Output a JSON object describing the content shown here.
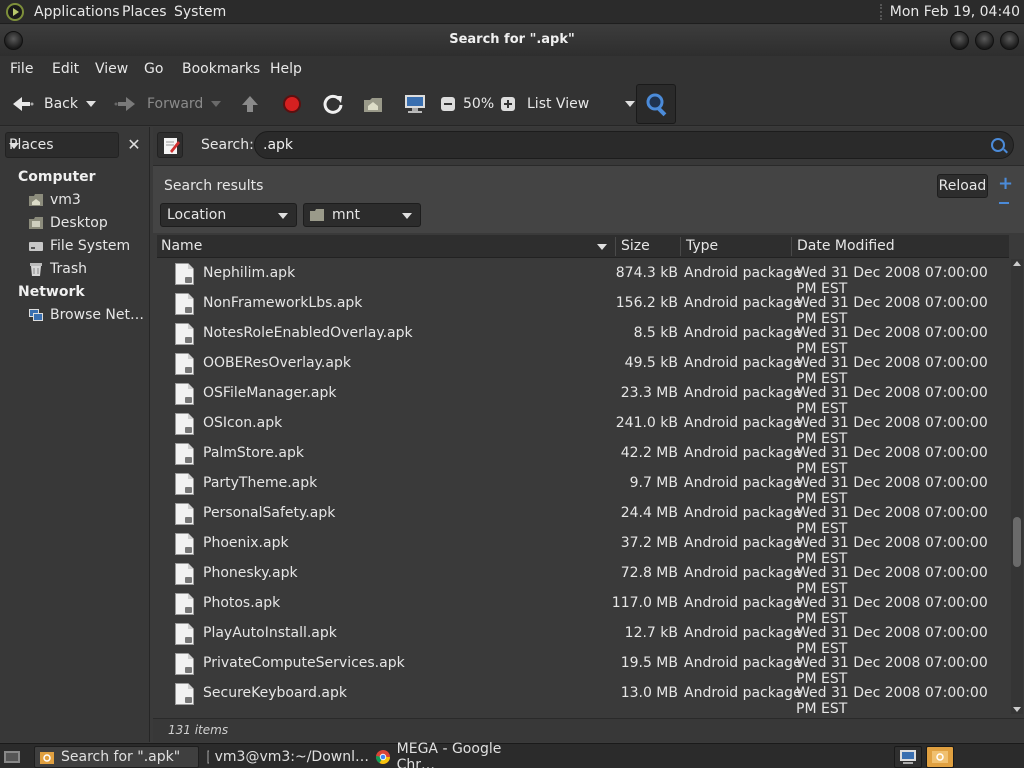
{
  "top_panel": {
    "menus": [
      "Applications",
      "Places",
      "System"
    ],
    "clock": "Mon Feb 19, 04:40"
  },
  "window": {
    "title": "Search for \".apk\""
  },
  "menubar": [
    "File",
    "Edit",
    "View",
    "Go",
    "Bookmarks",
    "Help"
  ],
  "toolbar": {
    "back_label": "Back",
    "forward_label": "Forward",
    "zoom_level": "50%",
    "view_mode": "List View"
  },
  "sidebar": {
    "selector_label": "Places",
    "sections": [
      {
        "heading": "Computer",
        "items": [
          {
            "label": "vm3",
            "icon": "home-folder-icon"
          },
          {
            "label": "Desktop",
            "icon": "desktop-folder-icon"
          },
          {
            "label": "File System",
            "icon": "drive-icon"
          },
          {
            "label": "Trash",
            "icon": "trash-icon"
          }
        ]
      },
      {
        "heading": "Network",
        "items": [
          {
            "label": "Browse Net…",
            "icon": "network-icon"
          }
        ]
      }
    ]
  },
  "search": {
    "label": "Search:",
    "query": ".apk",
    "results_title": "Search results",
    "reload_label": "Reload",
    "filter_type": "Location",
    "filter_value": "mnt"
  },
  "columns": {
    "name": "Name",
    "size": "Size",
    "type": "Type",
    "date": "Date Modified"
  },
  "files": [
    {
      "name": "Nephilim.apk",
      "size": "874.3 kB",
      "type": "Android package",
      "date": "Wed 31 Dec 2008 07:00:00 PM EST"
    },
    {
      "name": "NonFrameworkLbs.apk",
      "size": "156.2 kB",
      "type": "Android package",
      "date": "Wed 31 Dec 2008 07:00:00 PM EST"
    },
    {
      "name": "NotesRoleEnabledOverlay.apk",
      "size": "8.5 kB",
      "type": "Android package",
      "date": "Wed 31 Dec 2008 07:00:00 PM EST"
    },
    {
      "name": "OOBEResOverlay.apk",
      "size": "49.5 kB",
      "type": "Android package",
      "date": "Wed 31 Dec 2008 07:00:00 PM EST"
    },
    {
      "name": "OSFileManager.apk",
      "size": "23.3 MB",
      "type": "Android package",
      "date": "Wed 31 Dec 2008 07:00:00 PM EST"
    },
    {
      "name": "OSIcon.apk",
      "size": "241.0 kB",
      "type": "Android package",
      "date": "Wed 31 Dec 2008 07:00:00 PM EST"
    },
    {
      "name": "PalmStore.apk",
      "size": "42.2 MB",
      "type": "Android package",
      "date": "Wed 31 Dec 2008 07:00:00 PM EST"
    },
    {
      "name": "PartyTheme.apk",
      "size": "9.7 MB",
      "type": "Android package",
      "date": "Wed 31 Dec 2008 07:00:00 PM EST"
    },
    {
      "name": "PersonalSafety.apk",
      "size": "24.4 MB",
      "type": "Android package",
      "date": "Wed 31 Dec 2008 07:00:00 PM EST"
    },
    {
      "name": "Phoenix.apk",
      "size": "37.2 MB",
      "type": "Android package",
      "date": "Wed 31 Dec 2008 07:00:00 PM EST"
    },
    {
      "name": "Phonesky.apk",
      "size": "72.8 MB",
      "type": "Android package",
      "date": "Wed 31 Dec 2008 07:00:00 PM EST"
    },
    {
      "name": "Photos.apk",
      "size": "117.0 MB",
      "type": "Android package",
      "date": "Wed 31 Dec 2008 07:00:00 PM EST"
    },
    {
      "name": "PlayAutoInstall.apk",
      "size": "12.7 kB",
      "type": "Android package",
      "date": "Wed 31 Dec 2008 07:00:00 PM EST"
    },
    {
      "name": "PrivateComputeServices.apk",
      "size": "19.5 MB",
      "type": "Android package",
      "date": "Wed 31 Dec 2008 07:00:00 PM EST"
    },
    {
      "name": "SecureKeyboard.apk",
      "size": "13.0 MB",
      "type": "Android package",
      "date": "Wed 31 Dec 2008 07:00:00 PM EST"
    }
  ],
  "status": {
    "item_count": "131 items"
  },
  "taskbar": {
    "tasks": [
      {
        "label": "Search for \".apk\"",
        "icon": "folder-search-icon"
      },
      {
        "label": "vm3@vm3:~/Downl…",
        "icon": "terminal-icon"
      },
      {
        "label": "MEGA - Google Chr…",
        "icon": "chrome-icon"
      }
    ]
  },
  "colors": {
    "accent": "#4b8bd9",
    "stop": "#d62020",
    "background": "#3a3a3a"
  }
}
